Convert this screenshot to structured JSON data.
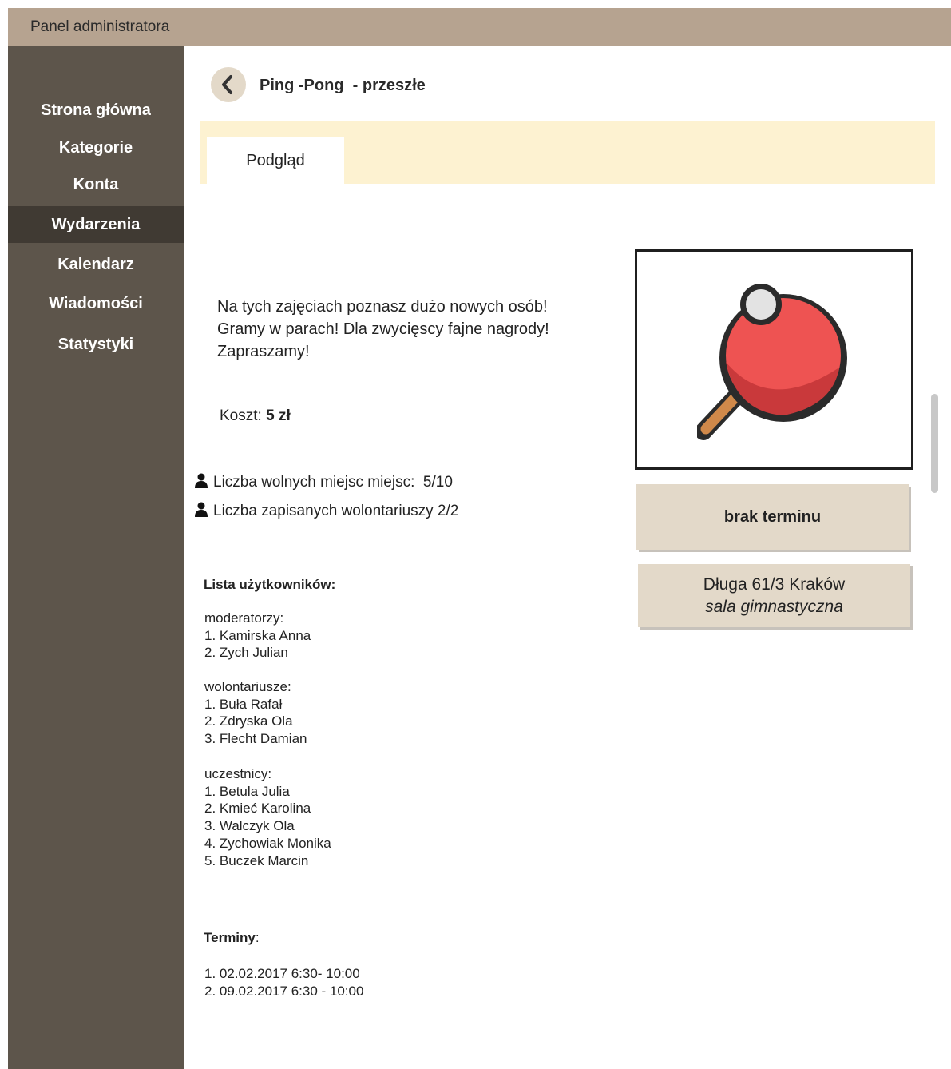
{
  "app": {
    "title": "Panel administratora"
  },
  "sidebar": {
    "items": [
      {
        "label": "Strona główna",
        "active": false
      },
      {
        "label": "Kategorie",
        "active": false
      },
      {
        "label": "Konta",
        "active": false
      },
      {
        "label": "Wydarzenia",
        "active": true
      },
      {
        "label": "Kalendarz",
        "active": false
      },
      {
        "label": "Wiadomości",
        "active": false
      },
      {
        "label": "Statystyki",
        "active": false
      }
    ]
  },
  "header": {
    "back_icon": "chevron-left-icon",
    "title": "Ping -Pong  - przeszłe"
  },
  "tabs": [
    {
      "label": "Podgląd",
      "active": true
    }
  ],
  "event": {
    "description": "Na tych zajęciach poznasz dużo nowych osób! Gramy w parach! Dla zwycięscy fajne nagrody! Zapraszamy!",
    "cost_label": "Koszt:",
    "cost_value": "5 zł",
    "free_places": "Liczba wolnych miejsc miejsc:  5/10",
    "volunteers": "Liczba zapisanych wolontariuszy 2/2",
    "stat_icon": "user-icon",
    "image_icon": "ping-pong-paddle-icon"
  },
  "users": {
    "heading": "Lista użytkowników:",
    "groups": [
      {
        "title": "moderatorzy:",
        "members": [
          "1. Kamirska Anna",
          "2. Zych Julian"
        ]
      },
      {
        "title": "wolontariusze:",
        "members": [
          "1. Buła Rafał",
          "2. Zdryska Ola",
          "3. Flecht Damian"
        ]
      },
      {
        "title": "uczestnicy:",
        "members": [
          "1. Betula Julia",
          "2. Kmieć Karolina",
          "3. Walczyk Ola",
          "4. Zychowiak Monika",
          "5. Buczek Marcin"
        ]
      }
    ]
  },
  "terms": {
    "heading": "Terminy",
    "colon": ":",
    "items": [
      "1. 02.02.2017 6:30- 10:00",
      "2. 09.02.2017 6:30 - 10:00"
    ]
  },
  "side_panel": {
    "no_term": "brak terminu",
    "address": "Długa 61/3 Kraków",
    "room": "sala gimnastyczna"
  },
  "colors": {
    "topbar": "#b6a390",
    "sidebar": "#5d554b",
    "sidebar_active": "#403a33",
    "tab_band": "#fdf2d1",
    "card": "#e3d9c9",
    "paddle_red": "#ee5352",
    "ball": "#e3e3e3"
  }
}
